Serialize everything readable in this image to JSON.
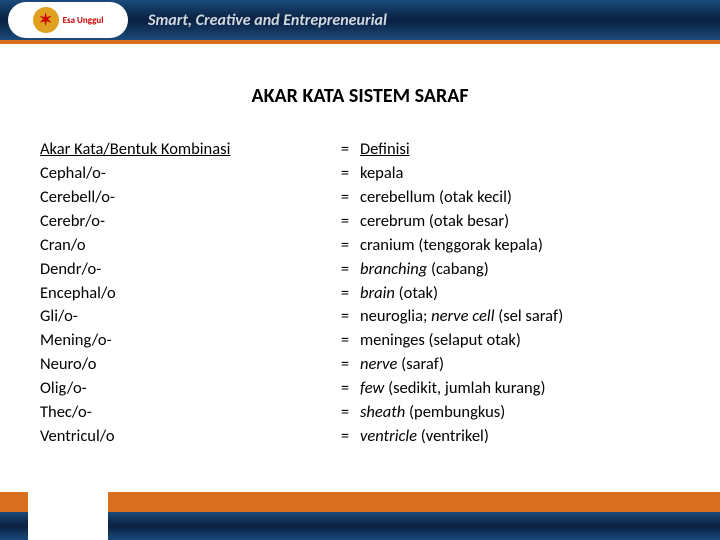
{
  "header": {
    "brand_text": "Esa Unggul",
    "tagline": "Smart, Creative and Entrepreneurial"
  },
  "title": "AKAR KATA SISTEM SARAF",
  "columns": {
    "root_header": "Akar Kata/Bentuk Kombinasi",
    "def_header": "Definisi"
  },
  "rows": [
    {
      "root": "Cephal/o-",
      "def_it": "",
      "def_plain": "kepala"
    },
    {
      "root": "Cerebell/o-",
      "def_it": "",
      "def_plain": "cerebellum (otak kecil)"
    },
    {
      "root": "Cerebr/o-",
      "def_it": "",
      "def_plain": "cerebrum (otak besar)"
    },
    {
      "root": "Cran/o",
      "def_it": "",
      "def_plain": "cranium (tenggorak kepala)"
    },
    {
      "root": "Dendr/o-",
      "def_it": "branching ",
      "def_plain": "(cabang)"
    },
    {
      "root": "Encephal/o",
      "def_it": "brain ",
      "def_plain": "(otak)"
    },
    {
      "root": "Gli/o-",
      "def_it": "",
      "def_plain": "neuroglia; ",
      "def_it2": "nerve cell ",
      "def_plain2": "(sel saraf)"
    },
    {
      "root": "Mening/o-",
      "def_it": "",
      "def_plain": "meninges (selaput otak)"
    },
    {
      "root": "Neuro/o",
      "def_it": "nerve ",
      "def_plain": "(saraf)"
    },
    {
      "root": "Olig/o-",
      "def_it": "few ",
      "def_plain": "(sedikit, jumlah kurang)"
    },
    {
      "root": "Thec/o-",
      "def_it": " sheath ",
      "def_plain": "(pembungkus)"
    },
    {
      "root": "Ventricul/o",
      "def_it": " ventricle ",
      "def_plain": "(ventrikel)"
    }
  ]
}
